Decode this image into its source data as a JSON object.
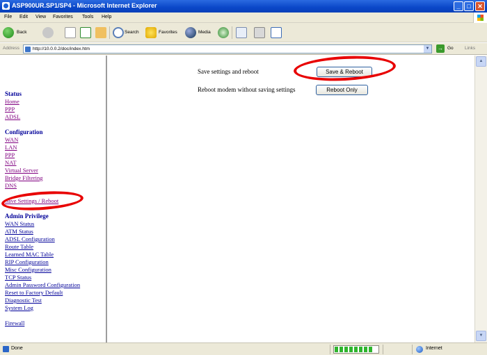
{
  "window": {
    "title": "ASP900UR.SP1/SP4 - Microsoft Internet Explorer"
  },
  "menu": [
    "File",
    "Edit",
    "View",
    "Favorites",
    "Tools",
    "Help"
  ],
  "toolbar": {
    "back": "Back",
    "search": "Search",
    "favorites": "Favorites",
    "media": "Media"
  },
  "address": {
    "label": "Address",
    "url": "http://10.0.0.2/doc/index.htm",
    "go": "Go",
    "links": "Links"
  },
  "sidebar": {
    "status_heading": "Status",
    "status_items": [
      "Home",
      "PPP",
      "ADSL"
    ],
    "config_heading": "Configuration",
    "config_items": [
      "WAN",
      "LAN",
      "PPP",
      "NAT",
      "Virtual Server",
      "Bridge Filtering",
      "DNS",
      "Save Settings / Reboot"
    ],
    "admin_heading": "Admin Privilege",
    "admin_items": [
      "WAN Status",
      "ATM Status",
      "ADSL Configuration",
      "Route Table",
      "Learned MAC Table",
      "RIP Configuration",
      "Misc Configuration",
      "TCP Status",
      "Admin Password Configuration",
      "Reset to Factory Default",
      "Diagnostic Test",
      "System Log"
    ],
    "firewall": "Firewall"
  },
  "main": {
    "row1_text": "Save settings and reboot",
    "row1_button": "Save & Reboot",
    "row2_text": "Reboot modem without saving settings",
    "row2_button": "Reboot Only"
  },
  "status": {
    "text": "Done",
    "zone": "Internet",
    "progress": 0.9
  },
  "colors": {
    "title_bar": "#0a47c8",
    "link": "#000099",
    "visited_link": "#800080",
    "highlight": "#e80000"
  }
}
